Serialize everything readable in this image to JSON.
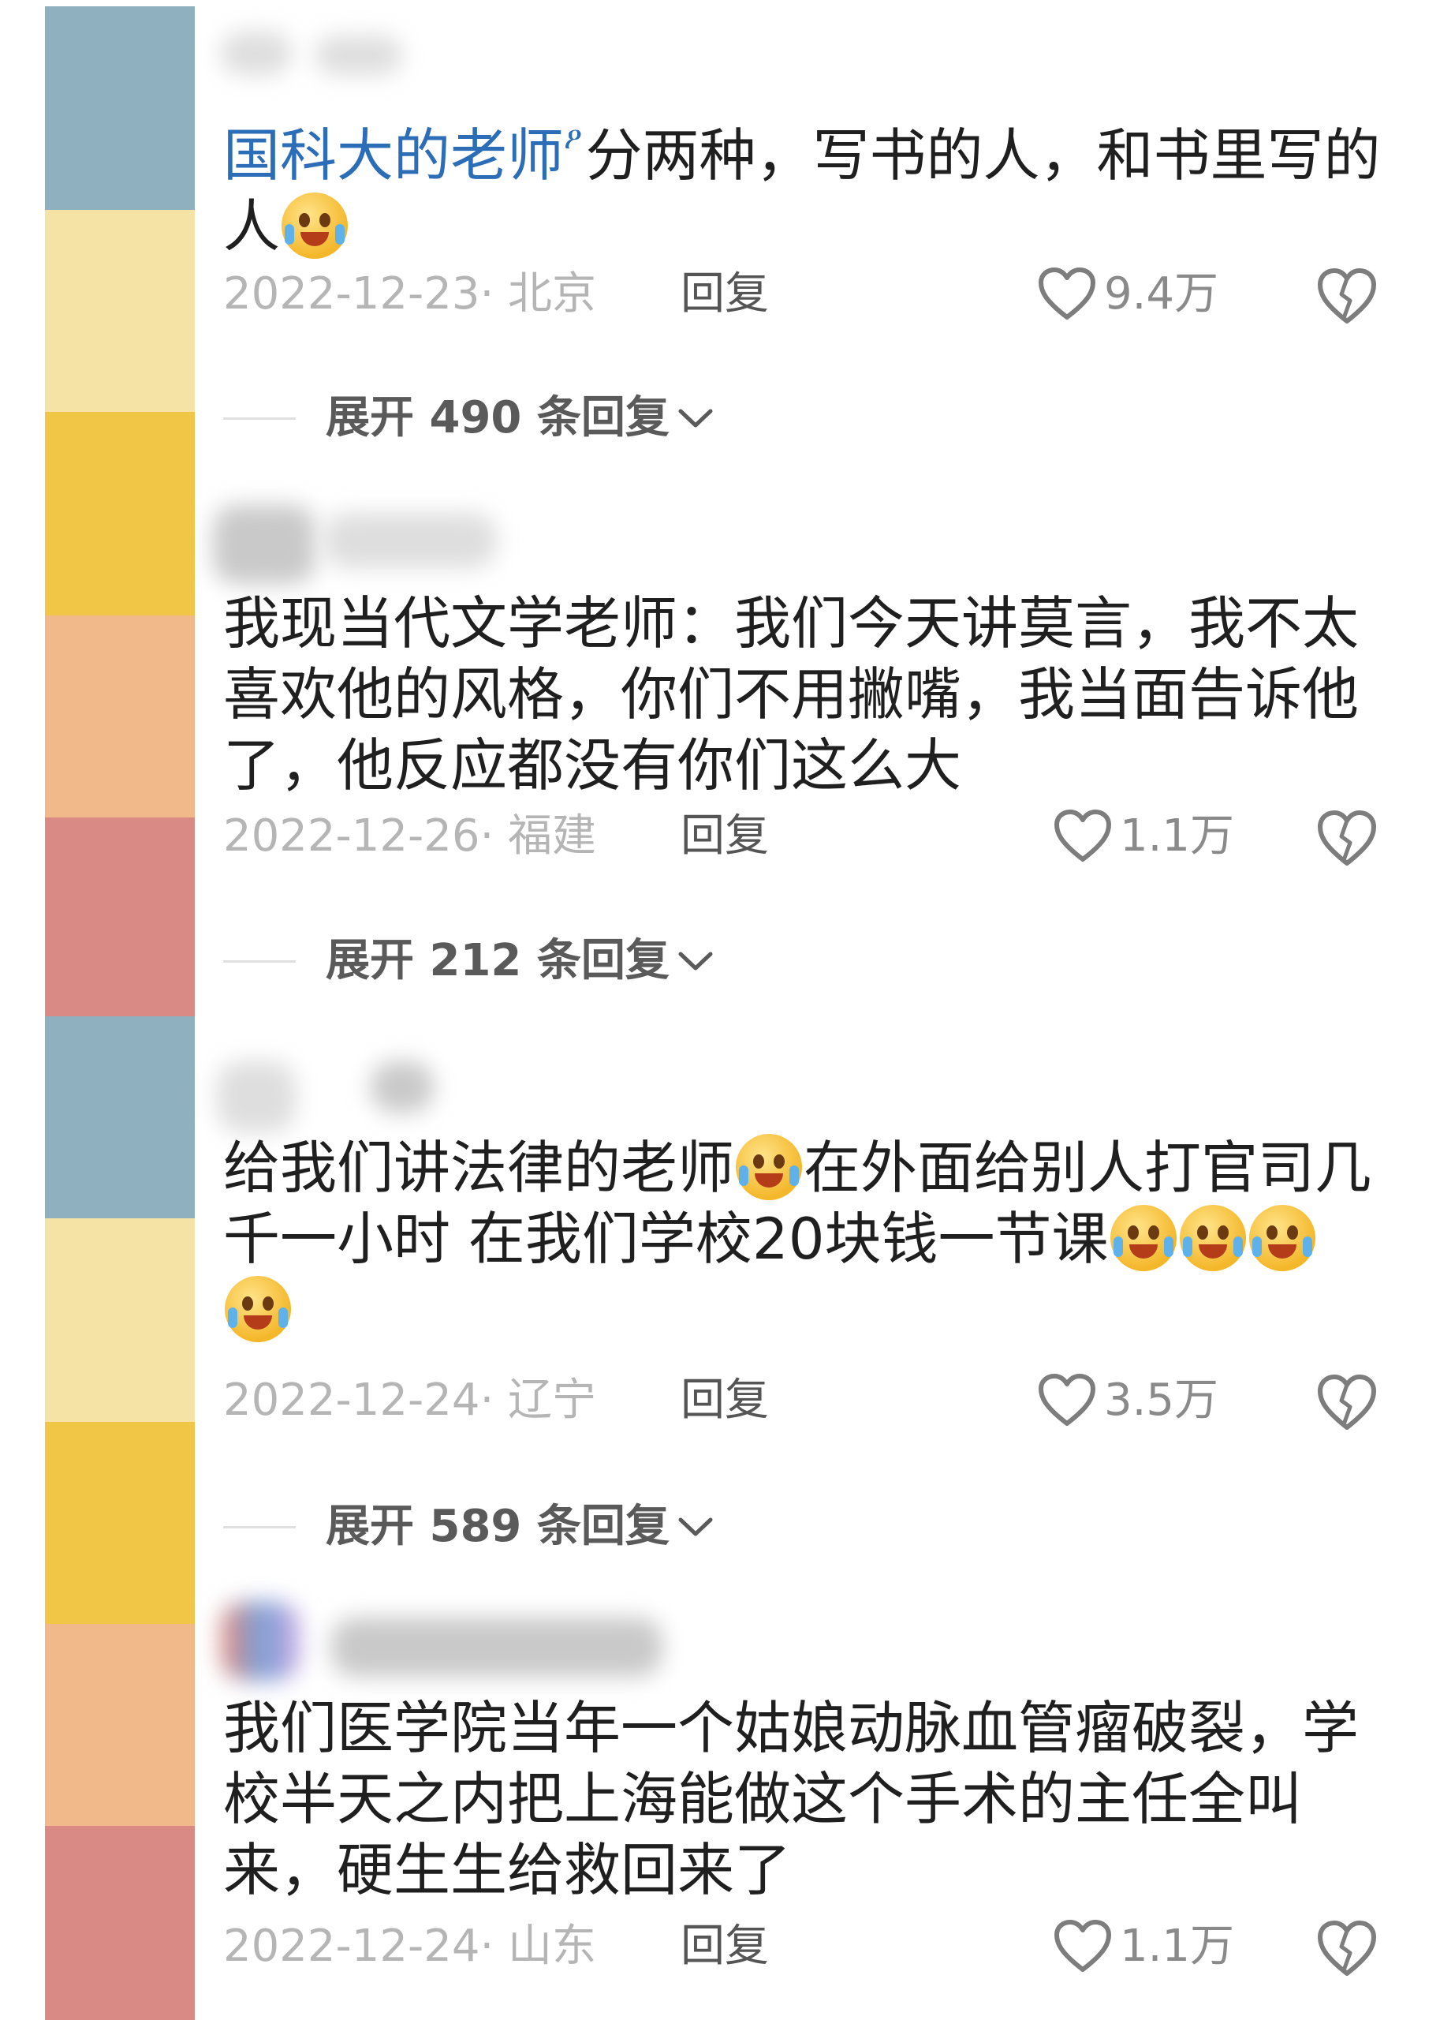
{
  "colors": {
    "strip": [
      "#8fb0be",
      "#f4e3a4",
      "#f1c646",
      "#f1b889",
      "#da8a85",
      "#8fb0be",
      "#f4e3a4",
      "#f1c646",
      "#f1b889",
      "#da8a85"
    ],
    "link": "#2c6db7",
    "text": "#1f1f1f",
    "meta": "#b5b5b5"
  },
  "icons": {
    "like": "heart-outline-icon",
    "dislike": "broken-heart-icon",
    "expand": "chevron-down-icon",
    "emoji_laugh": "tears-of-joy-emoji",
    "emoji_cry": "loud-crying-emoji"
  },
  "comments": [
    {
      "link_text": "国科大的老师",
      "link_marker": "ዖ",
      "text_line1": "分两种，写书的人，和书里写的",
      "text_line2": "人",
      "date": "2022-12-23",
      "location": "· 北京",
      "reply": "回复",
      "likes": "9.4万",
      "expand": "展开 490 条回复"
    },
    {
      "text_line1": "我现当代文学老师：我们今天讲莫言，我不太",
      "text_line2": "喜欢他的风格，你们不用撇嘴，我当面告诉他",
      "text_line3": "了，他反应都没有你们这么大",
      "date": "2022-12-26",
      "location": "· 福建",
      "reply": "回复",
      "likes": "1.1万",
      "expand": "展开 212 条回复"
    },
    {
      "text_line1a": "给我们讲法律的老师",
      "text_line1b": "在外面给别人打官司几",
      "text_line2": "千一小时 在我们学校20块钱一节课",
      "date": "2022-12-24",
      "location": "· 辽宁",
      "reply": "回复",
      "likes": "3.5万",
      "expand": "展开 589 条回复"
    },
    {
      "text_line1": "我们医学院当年一个姑娘动脉血管瘤破裂，学",
      "text_line2": "校半天之内把上海能做这个手术的主任全叫",
      "text_line3": "来，硬生生给救回来了",
      "date": "2022-12-24",
      "location": "· 山东",
      "reply": "回复",
      "likes": "1.1万"
    }
  ]
}
